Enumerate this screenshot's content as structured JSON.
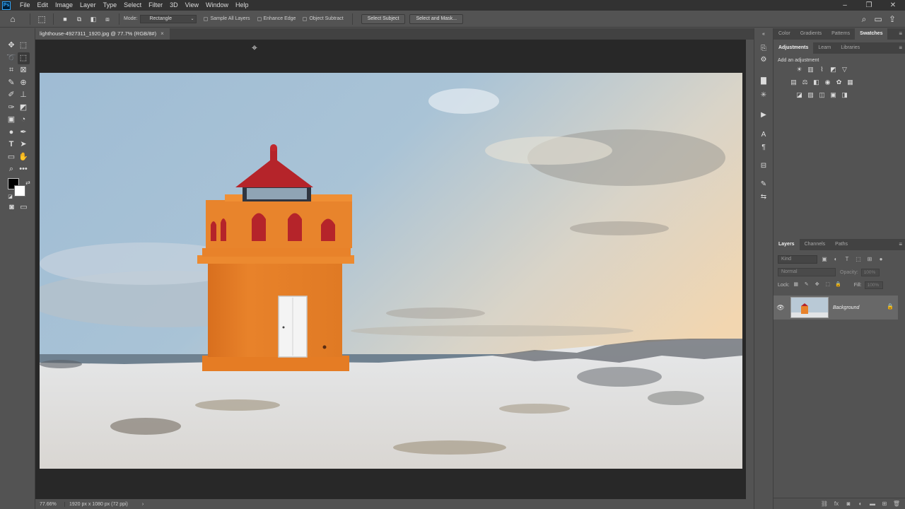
{
  "menubar": {
    "logo": "Ps",
    "items": [
      "File",
      "Edit",
      "Image",
      "Layer",
      "Type",
      "Select",
      "Filter",
      "3D",
      "View",
      "Window",
      "Help"
    ],
    "window_controls": [
      "–",
      "❐",
      "✕"
    ]
  },
  "options_bar": {
    "mode_label": "Mode:",
    "mode_value": "Rectangle",
    "sample_all_layers": "Sample All Layers",
    "enhance_edge": "Enhance Edge",
    "object_subtract": "Object Subtract",
    "select_subject": "Select Subject",
    "select_and_mask": "Select and Mask..."
  },
  "document": {
    "tab_title": "lighthouse-4927311_1920.jpg @ 77.7% (RGB/8#)",
    "zoom": "77.66%",
    "dimensions": "1920 px x 1080 px (72 ppi)"
  },
  "panels": {
    "top_tabs": [
      "Color",
      "Gradients",
      "Patterns",
      "Swatches"
    ],
    "top_active": "Swatches",
    "adj_tabs": [
      "Adjustments",
      "Learn",
      "Libraries"
    ],
    "adj_active": "Adjustments",
    "add_adjustment": "Add an adjustment",
    "layer_tabs": [
      "Layers",
      "Channels",
      "Paths"
    ],
    "layers_active": "Layers",
    "kind_placeholder": "Kind",
    "blend_mode": "Normal",
    "opacity_label": "Opacity:",
    "opacity_value": "100%",
    "lock_label": "Lock:",
    "fill_label": "Fill:",
    "fill_value": "100%",
    "layer_name": "Background"
  },
  "colors": {
    "foreground": "#000000",
    "background": "#ffffff",
    "lighthouse": "#e8822a",
    "roof": "#b5242a"
  }
}
